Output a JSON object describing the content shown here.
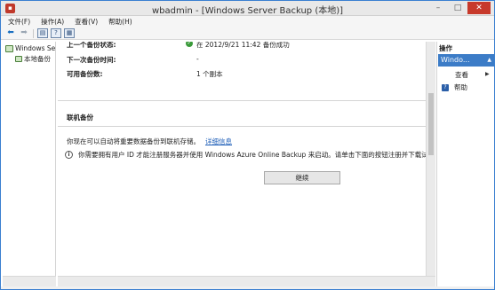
{
  "window": {
    "title": "wbadmin - [Windows Server Backup (本地)]",
    "minimize": "–",
    "maximize": "□",
    "close": "✕"
  },
  "menu": [
    "文件(F)",
    "操作(A)",
    "查看(V)",
    "帮助(H)"
  ],
  "toolbar": {
    "icons": [
      "back-arrow-icon",
      "forward-arrow-icon",
      "console-tree-icon",
      "help-icon",
      "properties-icon"
    ],
    "back": "⬅",
    "forward": "➡",
    "tree": "▤",
    "help": "?",
    "props": "▦"
  },
  "tree": {
    "root": "Windows Se",
    "child": "本地备份"
  },
  "status": {
    "last_backup_label": "上一个备份状态:",
    "last_backup_value": "在 2012/9/21 11:42 备份成功",
    "next_backup_label": "下一次备份时间:",
    "next_backup_value": "-",
    "available_label": "可用备份数:",
    "available_value": "1 个副本",
    "ok_mark": "✓"
  },
  "online": {
    "heading": "联机备份",
    "description": "你现在可以自动将重要数据备份到联机存储。",
    "link": "详细信息",
    "info_mark": "i",
    "info": "你需要拥有用户 ID 才能注册服务器并使用 Windows Azure Online Backup 来启动。请单击下面的按钮注册并下载试代理。",
    "continue_button": "继续"
  },
  "actions": {
    "header": "操作",
    "section": "Windo...",
    "section_arrow": "▲",
    "view": "查看",
    "view_arrow": "▶",
    "help": "帮助",
    "help_mark": "?"
  },
  "colors": {
    "accent": "#3c7cc7",
    "close": "#c7392b",
    "link": "#1f5fb8",
    "success": "#3a9a3a"
  }
}
